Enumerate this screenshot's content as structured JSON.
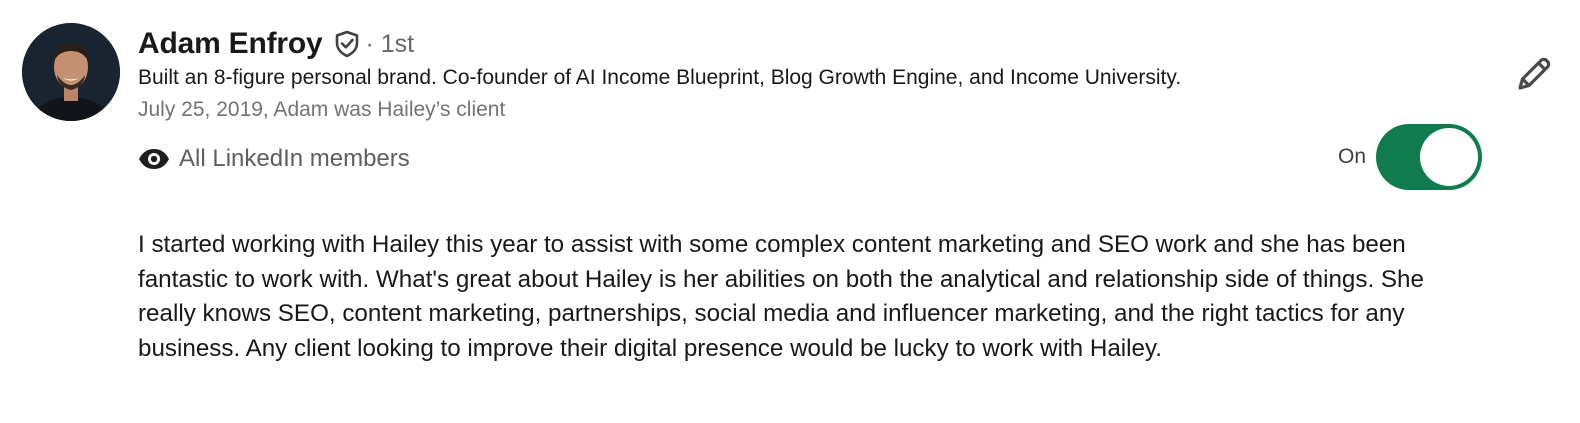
{
  "recommendation": {
    "author": {
      "name": "Adam Enfroy",
      "connection_degree": "· 1st",
      "headline": "Built an 8-figure personal brand. Co-founder of AI Income Blueprint, Blog Growth Engine, and Income University.",
      "relationship": "July 25, 2019, Adam was Hailey’s client"
    },
    "visibility": {
      "label": "All LinkedIn members",
      "toggle_label": "On",
      "toggle_on": true
    },
    "text": "I started working with Hailey this year to assist with some complex content marketing and SEO work and she has been fantastic to work with. What's great about Hailey is her abilities on both the analytical and relationship side of things. She really knows SEO, content marketing, partnerships, social media and influencer marketing, and the right tactics for any business. Any client looking to improve their digital presence would be lucky to work with Hailey."
  },
  "icons": {
    "verified": "verified-shield-icon",
    "edit": "pencil-icon",
    "visibility": "eye-icon"
  },
  "colors": {
    "toggle_on": "#0f7b4e",
    "muted_text": "#737373",
    "primary_text": "#191919"
  }
}
